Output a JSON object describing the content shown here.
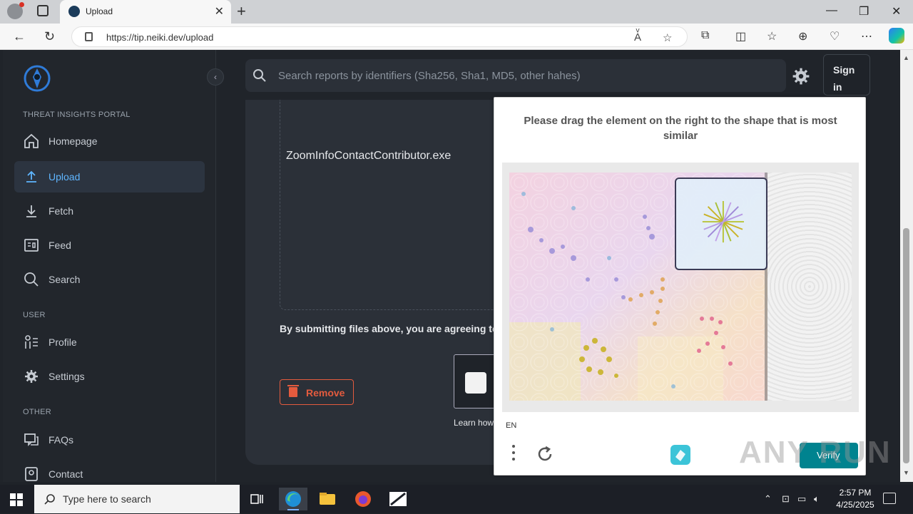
{
  "browser": {
    "tab_title": "Upload",
    "url": "https://tip.neiki.dev/upload",
    "window_controls": [
      "—",
      "❐",
      "✕"
    ]
  },
  "sidebar": {
    "portal_label": "THREAT INSIGHTS PORTAL",
    "user_label": "USER",
    "other_label": "OTHER",
    "items": [
      {
        "label": "Homepage",
        "icon": "home-icon"
      },
      {
        "label": "Upload",
        "icon": "upload-icon",
        "active": true
      },
      {
        "label": "Fetch",
        "icon": "fetch-icon"
      },
      {
        "label": "Feed",
        "icon": "feed-icon"
      },
      {
        "label": "Search",
        "icon": "search-icon"
      },
      {
        "label": "Profile",
        "icon": "profile-icon"
      },
      {
        "label": "Settings",
        "icon": "gear-icon"
      },
      {
        "label": "FAQs",
        "icon": "faq-icon"
      },
      {
        "label": "Contact",
        "icon": "contact-icon"
      }
    ]
  },
  "header": {
    "search_placeholder": "Search reports by identifiers (Sha256, Sha1, MD5, other hahes)",
    "signin_label": "Sign in"
  },
  "upload": {
    "filename": "ZoomInfoContactContributor.exe",
    "terms_text": "By submitting files above, you are agreeing to",
    "remove_label": "Remove",
    "learn_text": "Learn how"
  },
  "captcha": {
    "prompt": "Please drag the element on the right to the shape that is most similar",
    "language": "EN",
    "verify_label": "Verify"
  },
  "watermark": "ANY RUN",
  "taskbar": {
    "search_placeholder": "Type here to search",
    "time": "2:57 PM",
    "date": "4/25/2025"
  },
  "colors": {
    "accent": "#5fb6ff",
    "danger": "#e45b3e",
    "verify": "#00838f"
  }
}
